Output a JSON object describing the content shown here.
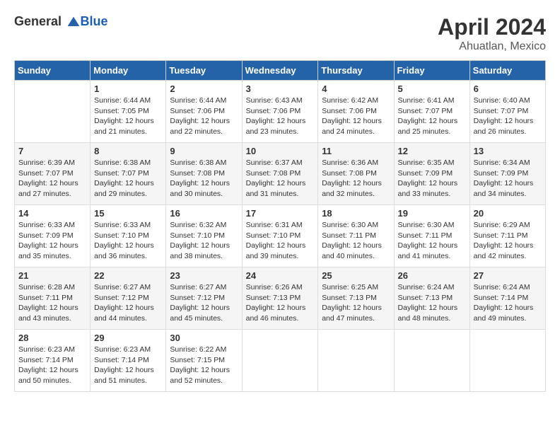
{
  "header": {
    "logo_general": "General",
    "logo_blue": "Blue",
    "month_year": "April 2024",
    "location": "Ahuatlan, Mexico"
  },
  "days_of_week": [
    "Sunday",
    "Monday",
    "Tuesday",
    "Wednesday",
    "Thursday",
    "Friday",
    "Saturday"
  ],
  "weeks": [
    [
      {
        "day": "",
        "info": ""
      },
      {
        "day": "1",
        "info": "Sunrise: 6:44 AM\nSunset: 7:05 PM\nDaylight: 12 hours\nand 21 minutes."
      },
      {
        "day": "2",
        "info": "Sunrise: 6:44 AM\nSunset: 7:06 PM\nDaylight: 12 hours\nand 22 minutes."
      },
      {
        "day": "3",
        "info": "Sunrise: 6:43 AM\nSunset: 7:06 PM\nDaylight: 12 hours\nand 23 minutes."
      },
      {
        "day": "4",
        "info": "Sunrise: 6:42 AM\nSunset: 7:06 PM\nDaylight: 12 hours\nand 24 minutes."
      },
      {
        "day": "5",
        "info": "Sunrise: 6:41 AM\nSunset: 7:07 PM\nDaylight: 12 hours\nand 25 minutes."
      },
      {
        "day": "6",
        "info": "Sunrise: 6:40 AM\nSunset: 7:07 PM\nDaylight: 12 hours\nand 26 minutes."
      }
    ],
    [
      {
        "day": "7",
        "info": "Sunrise: 6:39 AM\nSunset: 7:07 PM\nDaylight: 12 hours\nand 27 minutes."
      },
      {
        "day": "8",
        "info": "Sunrise: 6:38 AM\nSunset: 7:07 PM\nDaylight: 12 hours\nand 29 minutes."
      },
      {
        "day": "9",
        "info": "Sunrise: 6:38 AM\nSunset: 7:08 PM\nDaylight: 12 hours\nand 30 minutes."
      },
      {
        "day": "10",
        "info": "Sunrise: 6:37 AM\nSunset: 7:08 PM\nDaylight: 12 hours\nand 31 minutes."
      },
      {
        "day": "11",
        "info": "Sunrise: 6:36 AM\nSunset: 7:08 PM\nDaylight: 12 hours\nand 32 minutes."
      },
      {
        "day": "12",
        "info": "Sunrise: 6:35 AM\nSunset: 7:09 PM\nDaylight: 12 hours\nand 33 minutes."
      },
      {
        "day": "13",
        "info": "Sunrise: 6:34 AM\nSunset: 7:09 PM\nDaylight: 12 hours\nand 34 minutes."
      }
    ],
    [
      {
        "day": "14",
        "info": "Sunrise: 6:33 AM\nSunset: 7:09 PM\nDaylight: 12 hours\nand 35 minutes."
      },
      {
        "day": "15",
        "info": "Sunrise: 6:33 AM\nSunset: 7:10 PM\nDaylight: 12 hours\nand 36 minutes."
      },
      {
        "day": "16",
        "info": "Sunrise: 6:32 AM\nSunset: 7:10 PM\nDaylight: 12 hours\nand 38 minutes."
      },
      {
        "day": "17",
        "info": "Sunrise: 6:31 AM\nSunset: 7:10 PM\nDaylight: 12 hours\nand 39 minutes."
      },
      {
        "day": "18",
        "info": "Sunrise: 6:30 AM\nSunset: 7:11 PM\nDaylight: 12 hours\nand 40 minutes."
      },
      {
        "day": "19",
        "info": "Sunrise: 6:30 AM\nSunset: 7:11 PM\nDaylight: 12 hours\nand 41 minutes."
      },
      {
        "day": "20",
        "info": "Sunrise: 6:29 AM\nSunset: 7:11 PM\nDaylight: 12 hours\nand 42 minutes."
      }
    ],
    [
      {
        "day": "21",
        "info": "Sunrise: 6:28 AM\nSunset: 7:11 PM\nDaylight: 12 hours\nand 43 minutes."
      },
      {
        "day": "22",
        "info": "Sunrise: 6:27 AM\nSunset: 7:12 PM\nDaylight: 12 hours\nand 44 minutes."
      },
      {
        "day": "23",
        "info": "Sunrise: 6:27 AM\nSunset: 7:12 PM\nDaylight: 12 hours\nand 45 minutes."
      },
      {
        "day": "24",
        "info": "Sunrise: 6:26 AM\nSunset: 7:13 PM\nDaylight: 12 hours\nand 46 minutes."
      },
      {
        "day": "25",
        "info": "Sunrise: 6:25 AM\nSunset: 7:13 PM\nDaylight: 12 hours\nand 47 minutes."
      },
      {
        "day": "26",
        "info": "Sunrise: 6:24 AM\nSunset: 7:13 PM\nDaylight: 12 hours\nand 48 minutes."
      },
      {
        "day": "27",
        "info": "Sunrise: 6:24 AM\nSunset: 7:14 PM\nDaylight: 12 hours\nand 49 minutes."
      }
    ],
    [
      {
        "day": "28",
        "info": "Sunrise: 6:23 AM\nSunset: 7:14 PM\nDaylight: 12 hours\nand 50 minutes."
      },
      {
        "day": "29",
        "info": "Sunrise: 6:23 AM\nSunset: 7:14 PM\nDaylight: 12 hours\nand 51 minutes."
      },
      {
        "day": "30",
        "info": "Sunrise: 6:22 AM\nSunset: 7:15 PM\nDaylight: 12 hours\nand 52 minutes."
      },
      {
        "day": "",
        "info": ""
      },
      {
        "day": "",
        "info": ""
      },
      {
        "day": "",
        "info": ""
      },
      {
        "day": "",
        "info": ""
      }
    ]
  ]
}
